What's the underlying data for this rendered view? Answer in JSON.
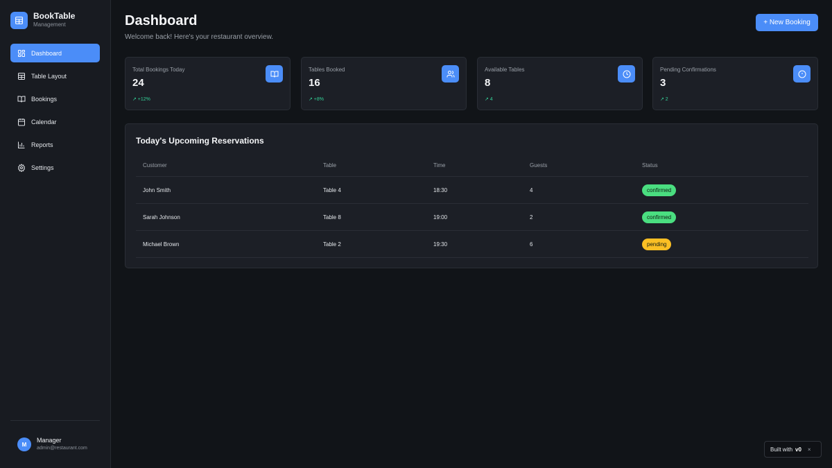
{
  "brand": {
    "name": "BookTable",
    "subtitle": "Management"
  },
  "sidebar": {
    "items": [
      {
        "label": "Dashboard",
        "icon": "dashboard-icon",
        "active": true
      },
      {
        "label": "Table Layout",
        "icon": "table-layout-icon"
      },
      {
        "label": "Bookings",
        "icon": "book-icon"
      },
      {
        "label": "Calendar",
        "icon": "calendar-icon"
      },
      {
        "label": "Reports",
        "icon": "bar-chart-icon"
      },
      {
        "label": "Settings",
        "icon": "gear-icon"
      }
    ]
  },
  "user": {
    "initial": "M",
    "name": "Manager",
    "email": "admin@restaurant.com"
  },
  "header": {
    "title": "Dashboard",
    "subtitle": "Welcome back! Here's your restaurant overview.",
    "new_booking_label": "+ New Booking"
  },
  "stats": [
    {
      "label": "Total Bookings Today",
      "value": "24",
      "trend": "↗ +12%",
      "icon": "book-icon"
    },
    {
      "label": "Tables Booked",
      "value": "16",
      "trend": "↗ +8%",
      "icon": "users-icon"
    },
    {
      "label": "Available Tables",
      "value": "8",
      "trend": "↗ 4",
      "icon": "clock-icon"
    },
    {
      "label": "Pending Confirmations",
      "value": "3",
      "trend": "↗ 2",
      "icon": "alert-circle-icon"
    }
  ],
  "reservations": {
    "title": "Today's Upcoming Reservations",
    "columns": [
      "Customer",
      "Table",
      "Time",
      "Guests",
      "Status"
    ],
    "rows": [
      {
        "customer": "John Smith",
        "table": "Table 4",
        "time": "18:30",
        "guests": "4",
        "status": "confirmed"
      },
      {
        "customer": "Sarah Johnson",
        "table": "Table 8",
        "time": "19:00",
        "guests": "2",
        "status": "confirmed"
      },
      {
        "customer": "Michael Brown",
        "table": "Table 2",
        "time": "19:30",
        "guests": "6",
        "status": "pending"
      }
    ]
  },
  "built_with": {
    "label": "Built with",
    "logo": "v0",
    "close": "×"
  },
  "colors": {
    "accent": "#4b8df8",
    "confirmed": "#4ade80",
    "pending": "#fbbf24",
    "trend": "#34d399"
  }
}
